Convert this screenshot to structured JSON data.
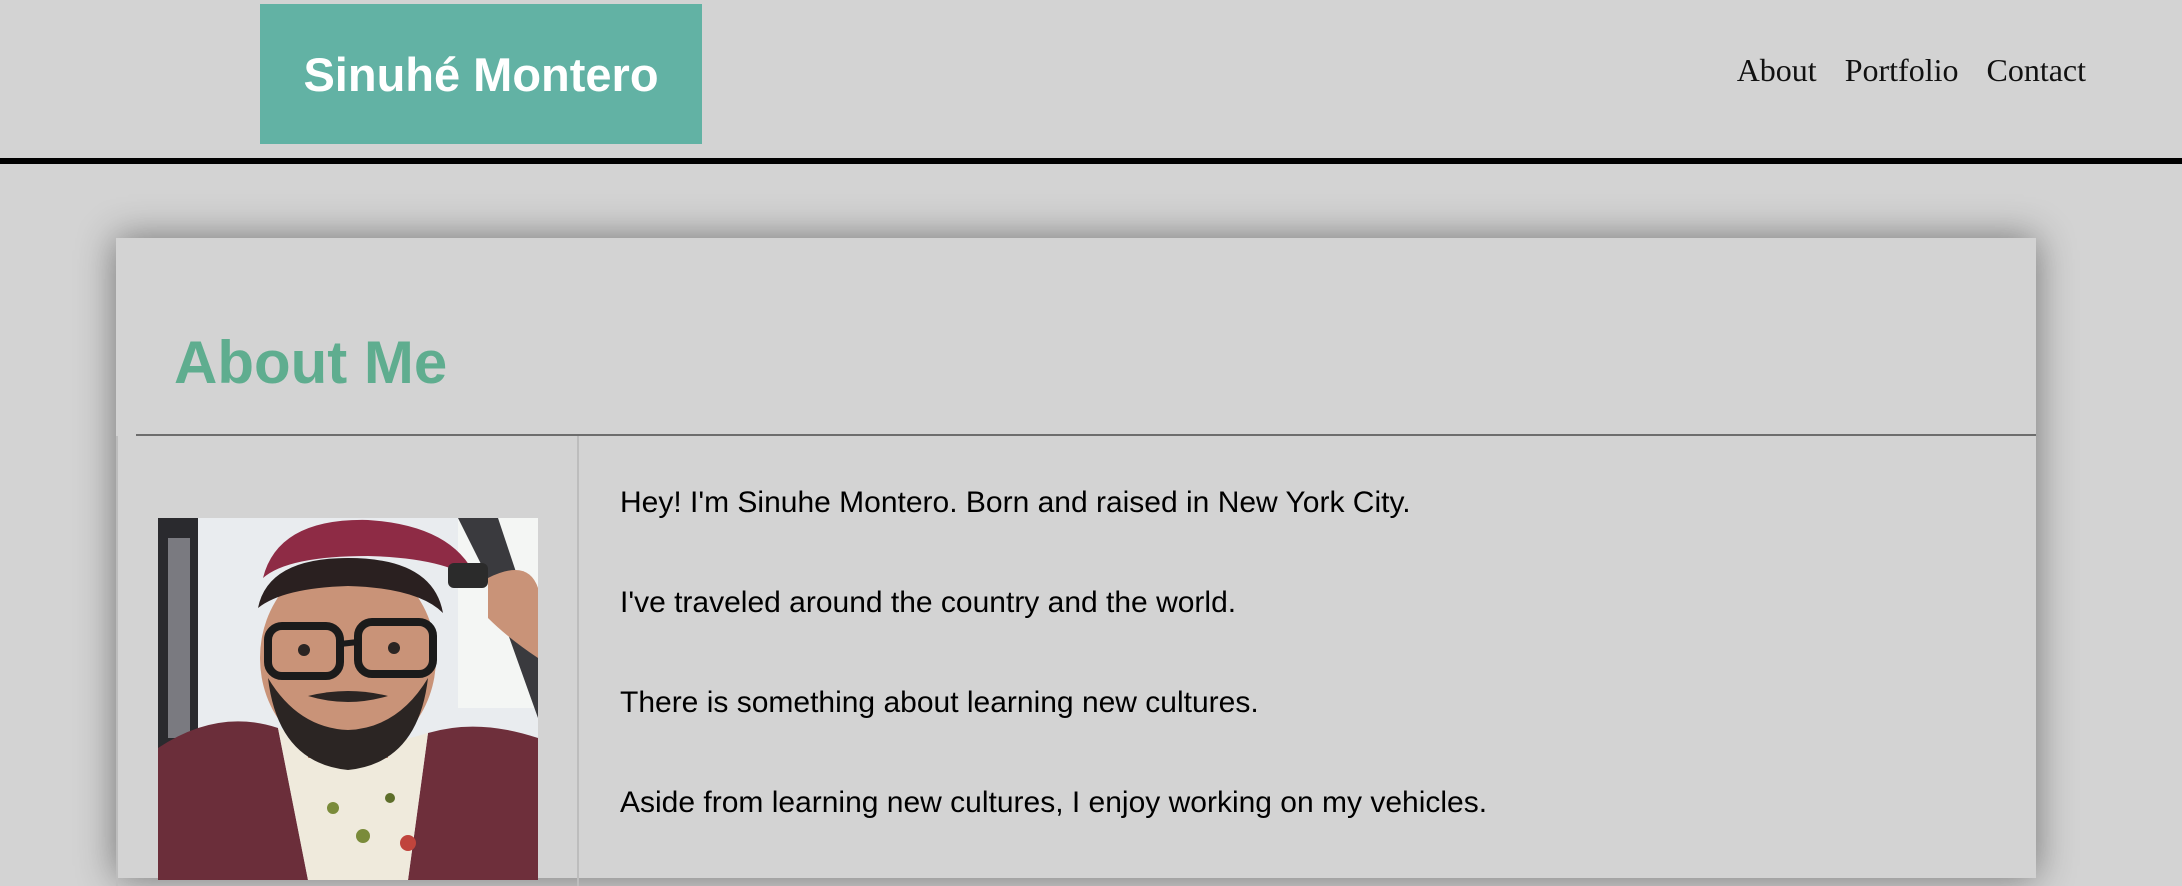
{
  "header": {
    "brand": "Sinuhé Montero",
    "nav": [
      "About",
      "Portfolio",
      "Contact"
    ],
    "brand_color": "#62b2a4"
  },
  "about": {
    "title": "About Me",
    "title_color": "#5fad8f",
    "paragraphs": [
      "Hey! I'm Sinuhe Montero. Born and raised in New York City.",
      "I've traveled around the country and the world.",
      "There is something about learning new cultures.",
      "Aside from learning new cultures, I enjoy working on my vehicles."
    ]
  }
}
